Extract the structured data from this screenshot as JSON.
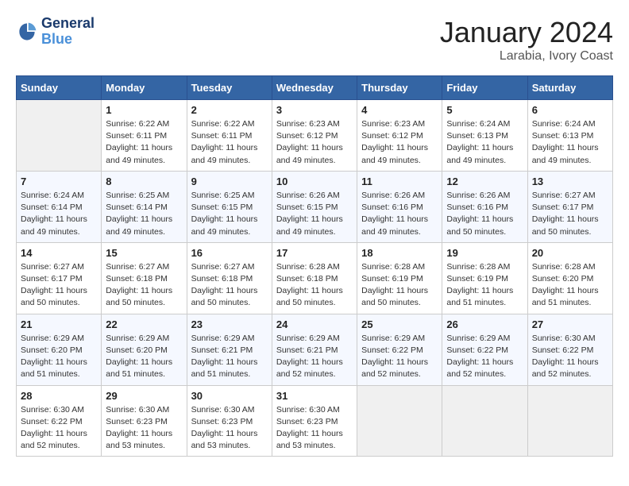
{
  "header": {
    "logo_line1": "General",
    "logo_line2": "Blue",
    "month": "January 2024",
    "location": "Larabia, Ivory Coast"
  },
  "weekdays": [
    "Sunday",
    "Monday",
    "Tuesday",
    "Wednesday",
    "Thursday",
    "Friday",
    "Saturday"
  ],
  "weeks": [
    [
      {
        "num": "",
        "detail": ""
      },
      {
        "num": "1",
        "detail": "Sunrise: 6:22 AM\nSunset: 6:11 PM\nDaylight: 11 hours\nand 49 minutes."
      },
      {
        "num": "2",
        "detail": "Sunrise: 6:22 AM\nSunset: 6:11 PM\nDaylight: 11 hours\nand 49 minutes."
      },
      {
        "num": "3",
        "detail": "Sunrise: 6:23 AM\nSunset: 6:12 PM\nDaylight: 11 hours\nand 49 minutes."
      },
      {
        "num": "4",
        "detail": "Sunrise: 6:23 AM\nSunset: 6:12 PM\nDaylight: 11 hours\nand 49 minutes."
      },
      {
        "num": "5",
        "detail": "Sunrise: 6:24 AM\nSunset: 6:13 PM\nDaylight: 11 hours\nand 49 minutes."
      },
      {
        "num": "6",
        "detail": "Sunrise: 6:24 AM\nSunset: 6:13 PM\nDaylight: 11 hours\nand 49 minutes."
      }
    ],
    [
      {
        "num": "7",
        "detail": "Sunrise: 6:24 AM\nSunset: 6:14 PM\nDaylight: 11 hours\nand 49 minutes."
      },
      {
        "num": "8",
        "detail": "Sunrise: 6:25 AM\nSunset: 6:14 PM\nDaylight: 11 hours\nand 49 minutes."
      },
      {
        "num": "9",
        "detail": "Sunrise: 6:25 AM\nSunset: 6:15 PM\nDaylight: 11 hours\nand 49 minutes."
      },
      {
        "num": "10",
        "detail": "Sunrise: 6:26 AM\nSunset: 6:15 PM\nDaylight: 11 hours\nand 49 minutes."
      },
      {
        "num": "11",
        "detail": "Sunrise: 6:26 AM\nSunset: 6:16 PM\nDaylight: 11 hours\nand 49 minutes."
      },
      {
        "num": "12",
        "detail": "Sunrise: 6:26 AM\nSunset: 6:16 PM\nDaylight: 11 hours\nand 50 minutes."
      },
      {
        "num": "13",
        "detail": "Sunrise: 6:27 AM\nSunset: 6:17 PM\nDaylight: 11 hours\nand 50 minutes."
      }
    ],
    [
      {
        "num": "14",
        "detail": "Sunrise: 6:27 AM\nSunset: 6:17 PM\nDaylight: 11 hours\nand 50 minutes."
      },
      {
        "num": "15",
        "detail": "Sunrise: 6:27 AM\nSunset: 6:18 PM\nDaylight: 11 hours\nand 50 minutes."
      },
      {
        "num": "16",
        "detail": "Sunrise: 6:27 AM\nSunset: 6:18 PM\nDaylight: 11 hours\nand 50 minutes."
      },
      {
        "num": "17",
        "detail": "Sunrise: 6:28 AM\nSunset: 6:18 PM\nDaylight: 11 hours\nand 50 minutes."
      },
      {
        "num": "18",
        "detail": "Sunrise: 6:28 AM\nSunset: 6:19 PM\nDaylight: 11 hours\nand 50 minutes."
      },
      {
        "num": "19",
        "detail": "Sunrise: 6:28 AM\nSunset: 6:19 PM\nDaylight: 11 hours\nand 51 minutes."
      },
      {
        "num": "20",
        "detail": "Sunrise: 6:28 AM\nSunset: 6:20 PM\nDaylight: 11 hours\nand 51 minutes."
      }
    ],
    [
      {
        "num": "21",
        "detail": "Sunrise: 6:29 AM\nSunset: 6:20 PM\nDaylight: 11 hours\nand 51 minutes."
      },
      {
        "num": "22",
        "detail": "Sunrise: 6:29 AM\nSunset: 6:20 PM\nDaylight: 11 hours\nand 51 minutes."
      },
      {
        "num": "23",
        "detail": "Sunrise: 6:29 AM\nSunset: 6:21 PM\nDaylight: 11 hours\nand 51 minutes."
      },
      {
        "num": "24",
        "detail": "Sunrise: 6:29 AM\nSunset: 6:21 PM\nDaylight: 11 hours\nand 52 minutes."
      },
      {
        "num": "25",
        "detail": "Sunrise: 6:29 AM\nSunset: 6:22 PM\nDaylight: 11 hours\nand 52 minutes."
      },
      {
        "num": "26",
        "detail": "Sunrise: 6:29 AM\nSunset: 6:22 PM\nDaylight: 11 hours\nand 52 minutes."
      },
      {
        "num": "27",
        "detail": "Sunrise: 6:30 AM\nSunset: 6:22 PM\nDaylight: 11 hours\nand 52 minutes."
      }
    ],
    [
      {
        "num": "28",
        "detail": "Sunrise: 6:30 AM\nSunset: 6:22 PM\nDaylight: 11 hours\nand 52 minutes."
      },
      {
        "num": "29",
        "detail": "Sunrise: 6:30 AM\nSunset: 6:23 PM\nDaylight: 11 hours\nand 53 minutes."
      },
      {
        "num": "30",
        "detail": "Sunrise: 6:30 AM\nSunset: 6:23 PM\nDaylight: 11 hours\nand 53 minutes."
      },
      {
        "num": "31",
        "detail": "Sunrise: 6:30 AM\nSunset: 6:23 PM\nDaylight: 11 hours\nand 53 minutes."
      },
      {
        "num": "",
        "detail": ""
      },
      {
        "num": "",
        "detail": ""
      },
      {
        "num": "",
        "detail": ""
      }
    ]
  ]
}
